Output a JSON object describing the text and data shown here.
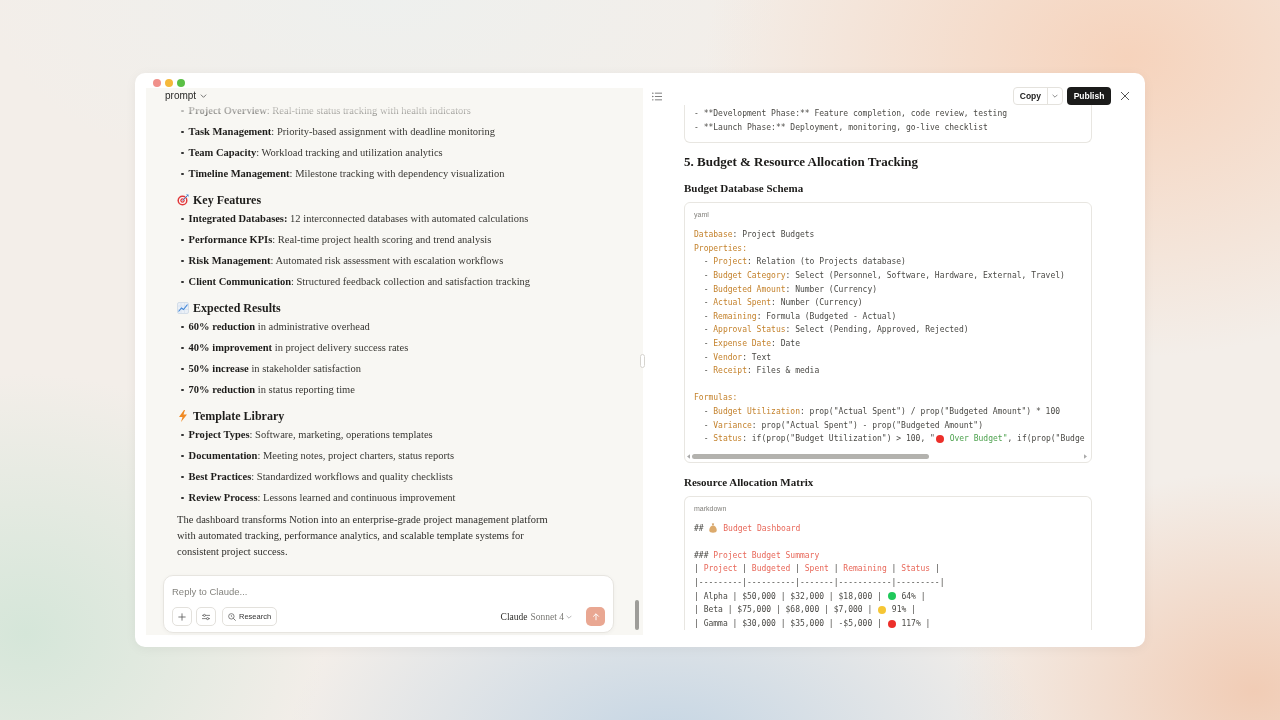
{
  "chat": {
    "title": "prompt",
    "content": [
      {
        "kind": "list",
        "items": [
          "**Project Overview**: Real-time status tracking with health indicators",
          "**Task Management**: Priority-based assignment with deadline monitoring",
          "**Team Capacity**: Workload tracking and utilization analytics",
          "**Timeline Management**: Milestone tracking with dependency visualization"
        ]
      },
      {
        "kind": "heading",
        "text": "Key Features"
      },
      {
        "kind": "list",
        "items": [
          "**Integrated Databases:** 12 interconnected databases with automated calculations",
          "**Performance KPIs**: Real-time project health scoring and trend analysis",
          "**Risk Management**: Automated risk assessment with escalation workflows",
          "**Client Communication**: Structured feedback collection and satisfaction tracking"
        ]
      },
      {
        "kind": "heading",
        "text": "Expected Results"
      },
      {
        "kind": "list",
        "items": [
          "**60% reduction** in administrative overhead",
          "**40% improvement** in project delivery success rates",
          "**50% increase** in stakeholder satisfaction",
          "**70% reduction** in status reporting time"
        ]
      },
      {
        "kind": "heading",
        "text": "Template Library"
      },
      {
        "kind": "list",
        "items": [
          "**Project Types**: Software, marketing, operations templates",
          "**Documentation**: Meeting notes, project charters, status reports",
          "**Best Practices**: Standardized workflows and quality checklists",
          "**Review Process**: Lessons learned and continuous improvement"
        ]
      },
      {
        "kind": "paragraph",
        "text": "The dashboard transforms Notion into an enterprise-grade project management platform with automated tracking, performance analytics, and scalable template systems for consistent project success."
      }
    ],
    "composer": {
      "placeholder": "Reply to Claude...",
      "research": "Research",
      "model_brand": "Claude",
      "model_name": "Sonnet 4",
      "send": {
        "disabled": true
      }
    }
  },
  "artifact": {
    "copy": "Copy",
    "publish": "Publish",
    "content": [
      {
        "kind": "code",
        "groups": [
          {
            "lines": [
              [
                {
                  "kind": "plain",
                  "text": "- **Development Phase:** Feature completion, code review, testing"
                }
              ],
              [
                {
                  "kind": "plain",
                  "text": "- **Launch Phase:** Deployment, monitoring, go-live checklist"
                }
              ]
            ]
          }
        ]
      },
      {
        "kind": "section",
        "text": "5. Budget & Resource Allocation Tracking"
      },
      {
        "kind": "subsection",
        "text": "Budget Database Schema"
      },
      {
        "kind": "code",
        "language": "yaml",
        "scrollable": true,
        "groups": [
          {
            "lines": [
              [
                {
                  "kind": "key",
                  "text": "Database"
                },
                {
                  "kind": "plain",
                  "text": ": Project Budgets"
                }
              ],
              [
                {
                  "kind": "key",
                  "text": "Properties:"
                }
              ],
              [
                {
                  "kind": "plain",
                  "text": "  - "
                },
                {
                  "kind": "key",
                  "text": "Project"
                },
                {
                  "kind": "plain",
                  "text": ": Relation (to Projects database)"
                }
              ],
              [
                {
                  "kind": "plain",
                  "text": "  - "
                },
                {
                  "kind": "key",
                  "text": "Budget Category"
                },
                {
                  "kind": "plain",
                  "text": ": Select (Personnel, Software, Hardware, External, Travel)"
                }
              ],
              [
                {
                  "kind": "plain",
                  "text": "  - "
                },
                {
                  "kind": "key",
                  "text": "Budgeted Amount"
                },
                {
                  "kind": "plain",
                  "text": ": Number (Currency)"
                }
              ],
              [
                {
                  "kind": "plain",
                  "text": "  - "
                },
                {
                  "kind": "key",
                  "text": "Actual Spent"
                },
                {
                  "kind": "plain",
                  "text": ": Number (Currency)"
                }
              ],
              [
                {
                  "kind": "plain",
                  "text": "  - "
                },
                {
                  "kind": "key",
                  "text": "Remaining"
                },
                {
                  "kind": "plain",
                  "text": ": Formula (Budgeted - Actual)"
                }
              ],
              [
                {
                  "kind": "plain",
                  "text": "  - "
                },
                {
                  "kind": "key",
                  "text": "Approval Status"
                },
                {
                  "kind": "plain",
                  "text": ": Select (Pending, Approved, Rejected)"
                }
              ],
              [
                {
                  "kind": "plain",
                  "text": "  - "
                },
                {
                  "kind": "key",
                  "text": "Expense Date"
                },
                {
                  "kind": "plain",
                  "text": ": Date"
                }
              ],
              [
                {
                  "kind": "plain",
                  "text": "  - "
                },
                {
                  "kind": "key",
                  "text": "Vendor"
                },
                {
                  "kind": "plain",
                  "text": ": Text"
                }
              ],
              [
                {
                  "kind": "plain",
                  "text": "  - "
                },
                {
                  "kind": "key",
                  "text": "Receipt"
                },
                {
                  "kind": "plain",
                  "text": ": Files & media"
                }
              ]
            ]
          },
          {
            "lines": [
              [
                {
                  "kind": "key",
                  "text": "Formulas:"
                }
              ],
              [
                {
                  "kind": "plain",
                  "text": "  - "
                },
                {
                  "kind": "key",
                  "text": "Budget Utilization"
                },
                {
                  "kind": "plain",
                  "text": ": prop(\"Actual Spent\") / prop(\"Budgeted Amount\") * 100"
                }
              ],
              [
                {
                  "kind": "plain",
                  "text": "  - "
                },
                {
                  "kind": "key",
                  "text": "Variance"
                },
                {
                  "kind": "plain",
                  "text": ": prop(\"Actual Spent\") - prop(\"Budgeted Amount\")"
                }
              ],
              [
                {
                  "kind": "plain",
                  "text": "  - "
                },
                {
                  "kind": "key",
                  "text": "Status"
                },
                {
                  "kind": "plain",
                  "text": ": if(prop(\"Budget Utilization\") > 100, \""
                },
                {
                  "kind": "dot",
                  "color": "#ec2f2a"
                },
                {
                  "kind": "string",
                  "text": " Over Budget\""
                },
                {
                  "kind": "plain",
                  "text": ", if(prop(\"Budge"
                }
              ]
            ]
          }
        ]
      },
      {
        "kind": "subsection",
        "text": "Resource Allocation Matrix"
      },
      {
        "kind": "code",
        "language": "markdown",
        "scrollable": false,
        "groups": [
          {
            "lines": [
              [
                {
                  "kind": "plain",
                  "text": "## "
                },
                {
                  "kind": "emoji"
                },
                {
                  "kind": "heading",
                  "text": " Budget Dashboard"
                }
              ]
            ]
          },
          {
            "lines": [
              [
                {
                  "kind": "plain",
                  "text": "### "
                },
                {
                  "kind": "heading",
                  "text": "Project Budget Summary"
                }
              ],
              [
                {
                  "kind": "plain",
                  "text": "| "
                },
                {
                  "kind": "heading",
                  "text": "Project"
                },
                {
                  "kind": "plain",
                  "text": " | "
                },
                {
                  "kind": "heading",
                  "text": "Budgeted"
                },
                {
                  "kind": "plain",
                  "text": " | "
                },
                {
                  "kind": "heading",
                  "text": "Spent"
                },
                {
                  "kind": "plain",
                  "text": " | "
                },
                {
                  "kind": "heading",
                  "text": "Remaining"
                },
                {
                  "kind": "plain",
                  "text": " | "
                },
                {
                  "kind": "heading",
                  "text": "Status"
                },
                {
                  "kind": "plain",
                  "text": " |"
                }
              ],
              [
                {
                  "kind": "plain",
                  "text": "|---------|----------|-------|-----------|---------|"
                }
              ],
              [
                {
                  "kind": "plain",
                  "text": "| Alpha | $50,000 | $32,000 | $18,000 | "
                },
                {
                  "kind": "dot",
                  "color": "#1fc85a"
                },
                {
                  "kind": "plain",
                  "text": " 64% |"
                }
              ],
              [
                {
                  "kind": "plain",
                  "text": "| Beta | $75,000 | $68,000 | $7,000 | "
                },
                {
                  "kind": "dot",
                  "color": "#f6c635"
                },
                {
                  "kind": "plain",
                  "text": " 91% |"
                }
              ],
              [
                {
                  "kind": "plain",
                  "text": "| Gamma | $30,000 | $35,000 | -$5,000 | "
                },
                {
                  "kind": "dot",
                  "color": "#ec2f2a"
                },
                {
                  "kind": "plain",
                  "text": " 117% |"
                }
              ]
            ]
          }
        ]
      }
    ]
  }
}
